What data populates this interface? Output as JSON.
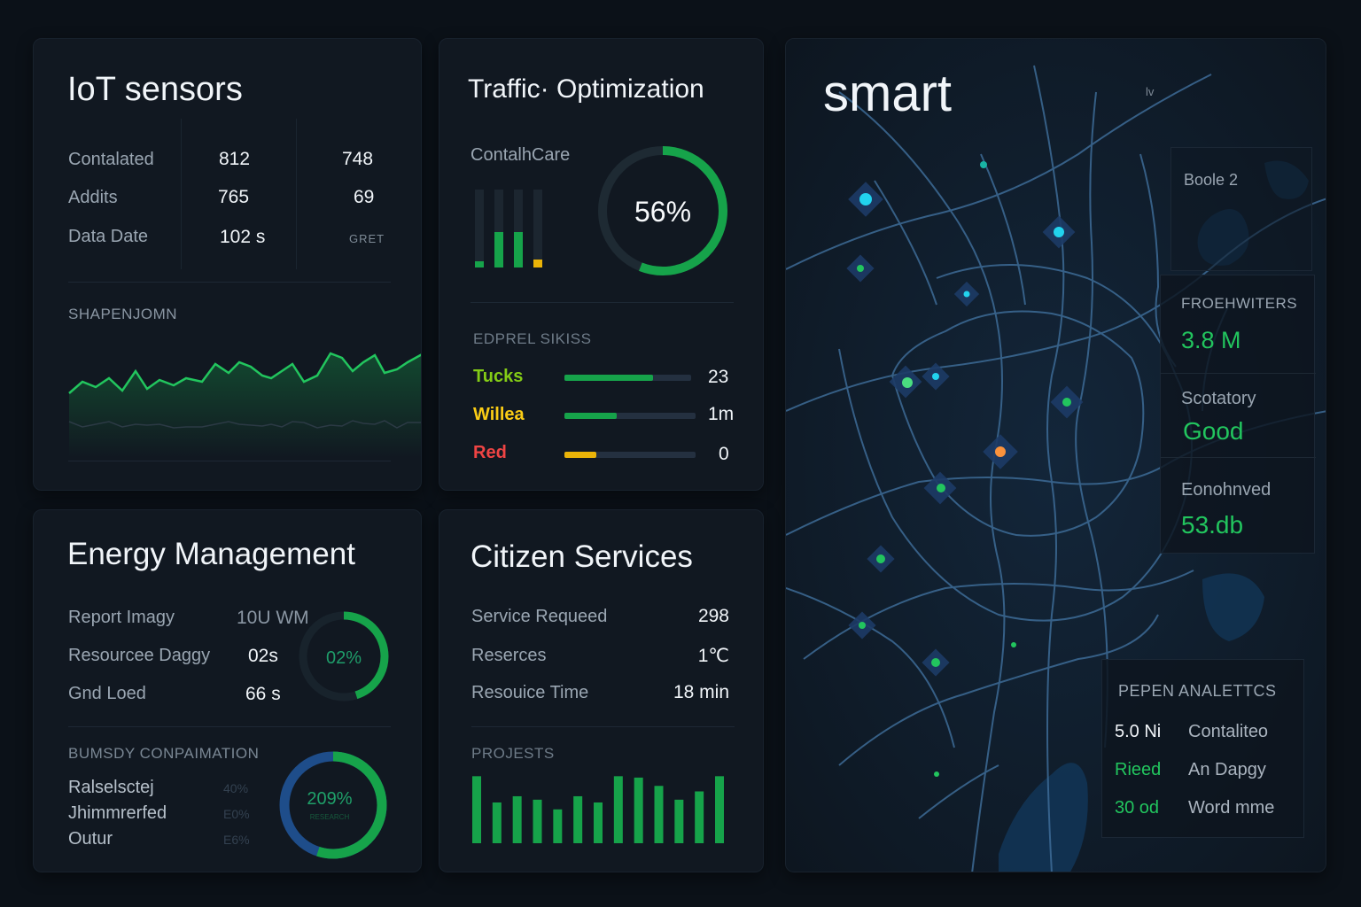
{
  "iot": {
    "title": "IoT sensors",
    "rows": [
      {
        "label": "Contalated",
        "v1": "812",
        "v2": "748"
      },
      {
        "label": "Addits",
        "v1": "765",
        "v2": "69"
      },
      {
        "label": "Data Date",
        "v1": "102 s",
        "v2": "GRET"
      }
    ],
    "chart_label": "SHAPENJOMN",
    "line_color": "#22c55e"
  },
  "traffic": {
    "title": "Traffic· Optimization",
    "sub": "ContalhCare",
    "gauge_percent": 56,
    "gauge_label": "56%",
    "mini_bars": [
      {
        "level": 0.08,
        "color": "#16a34a"
      },
      {
        "level": 0.45,
        "color": "#16a34a"
      },
      {
        "level": 0.45,
        "color": "#16a34a"
      },
      {
        "level": 0.1,
        "color": "#eab308"
      }
    ],
    "section_label": "EDPREL SIKISS",
    "status_rows": [
      {
        "label": "Tucks",
        "value": "23",
        "level": 0.7,
        "label_color": "#84cc16",
        "bar_color": "#16a34a"
      },
      {
        "label": "Willea",
        "value": "1m",
        "level": 0.4,
        "label_color": "#facc15",
        "bar_color": "#16a34a"
      },
      {
        "label": "Red",
        "value": "0",
        "level": 0.24,
        "label_color": "#ef4444",
        "bar_color": "#eab308"
      }
    ]
  },
  "map": {
    "title": "smart",
    "small_marker": "lv",
    "area_label": "Boole 2",
    "stats": [
      {
        "label": "FROEHWITERS",
        "value": "3.8 M"
      },
      {
        "label": "Scotatory",
        "value": "Good"
      },
      {
        "label": "Eonohnved",
        "value": "53.db"
      }
    ],
    "analytics_title": "PEPEN ANALETTCS",
    "analytics_rows": [
      {
        "left": "5.0 Ni",
        "right": "Contaliteo",
        "left_color": "#f1f5f9"
      },
      {
        "left": "Rieed",
        "right": "An Dapgy",
        "left_color": "#22c55e"
      },
      {
        "left": "30 od",
        "right": "Word mme",
        "left_color": "#22c55e"
      }
    ]
  },
  "energy": {
    "title": "Energy Management",
    "rows": [
      {
        "label": "Report Imagy",
        "value": "10U WM"
      },
      {
        "label": "Resourcee Daggy",
        "value": "02s"
      },
      {
        "label": "Gnd Loed",
        "value": "66 s"
      }
    ],
    "gauge_label": "02%",
    "gauge_level": 0.45,
    "section_label": "BUMSDY CONPAIMATION",
    "list": [
      {
        "label": "Ralselsctej",
        "pct": "40%"
      },
      {
        "label": "Jhimmrerfed",
        "pct": "E0%"
      },
      {
        "label": "Outur",
        "pct": "E6%"
      }
    ],
    "donut_label": "209%",
    "donut_sub": "RESEARCH",
    "donut_level": 0.55
  },
  "citizen": {
    "title": "Citizen Services",
    "rows": [
      {
        "label": "Service Requeed",
        "value": "298"
      },
      {
        "label": "Reserces",
        "value": "1℃"
      },
      {
        "label": "Resouice Time",
        "value": "18 min"
      }
    ],
    "section_label": "PROJESTS",
    "bars": [
      0.97,
      0.59,
      0.68,
      0.63,
      0.49,
      0.68,
      0.59,
      0.97,
      0.95,
      0.83,
      0.63,
      0.75,
      0.97
    ],
    "bar_color": "#16a34a"
  }
}
